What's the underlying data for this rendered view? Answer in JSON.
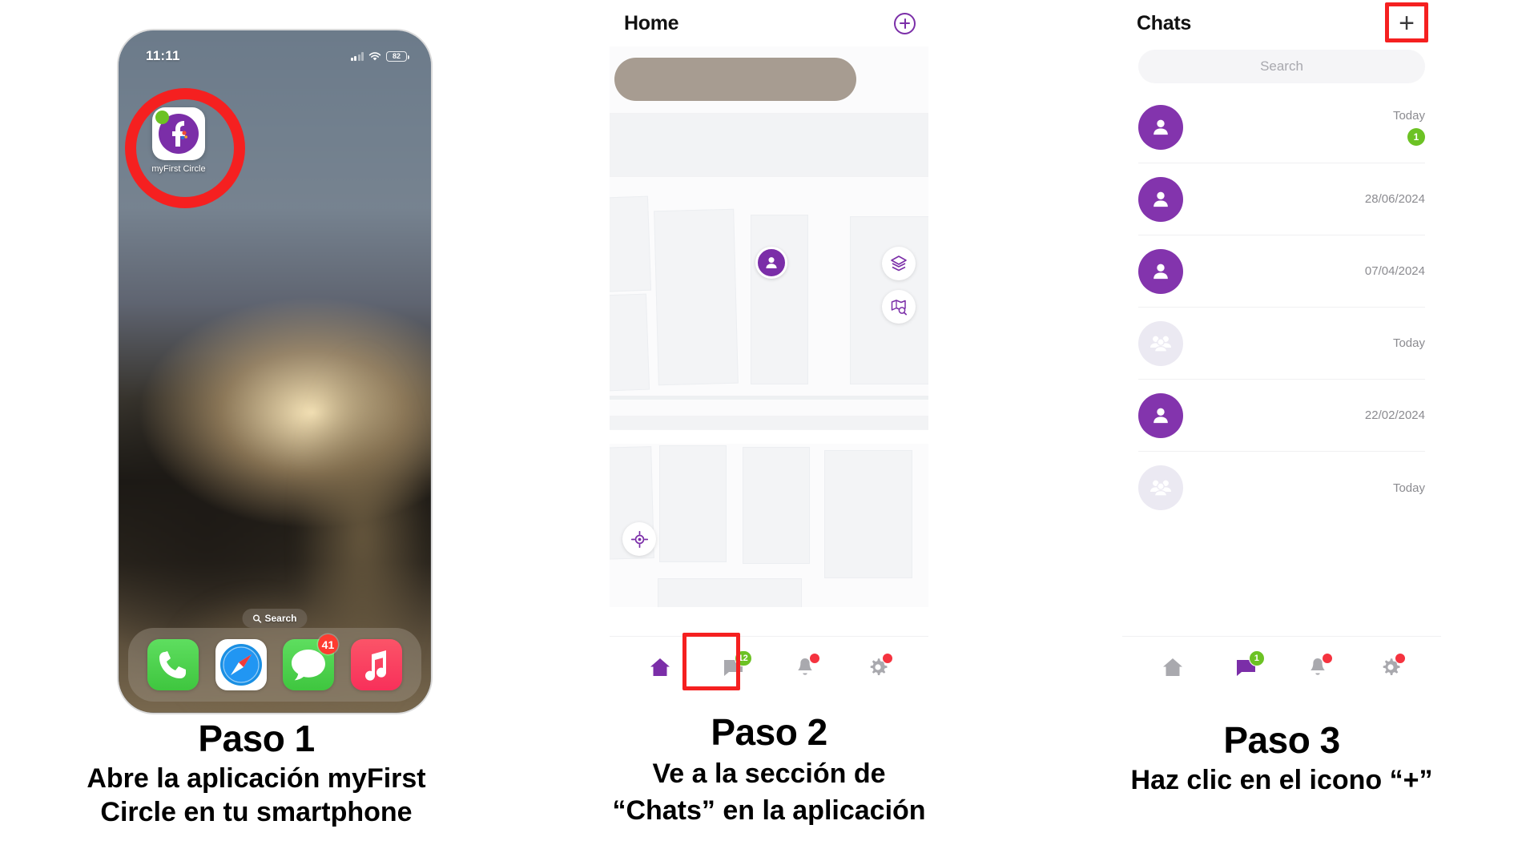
{
  "steps": [
    {
      "title": "Paso 1",
      "body": "Abre la aplicación myFirst\nCircle en tu smartphone"
    },
    {
      "title": "Paso 2",
      "body": "Ve a la sección de\n“Chats” en la aplicación"
    },
    {
      "title": "Paso 3",
      "body": "Haz clic en el icono “+”"
    }
  ],
  "phone1": {
    "status_bar": {
      "time": "11:11",
      "signal_icon": "cellular-signal-icon",
      "wifi_icon": "wifi-icon",
      "battery_level": "82"
    },
    "app_icon": {
      "label": "myFirst Circle",
      "icon_name": "myfirst-circle-app-icon"
    },
    "search_pill": {
      "label": "Search",
      "icon_name": "search-icon"
    },
    "dock": [
      {
        "name": "Phone",
        "icon": "phone-icon",
        "badge": ""
      },
      {
        "name": "Safari",
        "icon": "safari-compass-icon",
        "badge": ""
      },
      {
        "name": "Messages",
        "icon": "messages-bubble-icon",
        "badge": "41"
      },
      {
        "name": "Music",
        "icon": "music-note-icon",
        "badge": ""
      }
    ],
    "highlight": "red-circle-around-app-icon"
  },
  "phone2": {
    "header": {
      "title": "Home",
      "action_icon": "plus-circle-icon"
    },
    "map": {
      "user_marker_icon": "person-marker-icon",
      "controls": [
        {
          "icon": "locate-crosshair-icon"
        },
        {
          "icon": "map-layers-icon"
        },
        {
          "icon": "map-search-icon"
        }
      ]
    },
    "nav": [
      {
        "name": "home",
        "icon": "home-icon",
        "active": true,
        "badge": "",
        "badge_type": "none"
      },
      {
        "name": "chats",
        "icon": "chat-icon",
        "active": false,
        "badge": "12",
        "badge_type": "green"
      },
      {
        "name": "alerts",
        "icon": "bell-icon",
        "active": false,
        "badge": "",
        "badge_type": "reddot"
      },
      {
        "name": "settings",
        "icon": "gear-icon",
        "active": false,
        "badge": "",
        "badge_type": "reddot"
      }
    ],
    "highlight": "red-box-around-chats-tab"
  },
  "phone3": {
    "header": {
      "title": "Chats",
      "action_label": "+",
      "action_icon": "plus-icon"
    },
    "search": {
      "placeholder": "Search"
    },
    "chats": [
      {
        "avatar": "person",
        "date": "Today",
        "unread": "1"
      },
      {
        "avatar": "person",
        "date": "28/06/2024",
        "unread": ""
      },
      {
        "avatar": "person",
        "date": "07/04/2024",
        "unread": ""
      },
      {
        "avatar": "group",
        "date": "Today",
        "unread": ""
      },
      {
        "avatar": "person",
        "date": "22/02/2024",
        "unread": ""
      },
      {
        "avatar": "group",
        "date": "Today",
        "unread": ""
      }
    ],
    "nav": [
      {
        "name": "home",
        "icon": "home-icon",
        "active": false,
        "badge": "",
        "badge_type": "none"
      },
      {
        "name": "chats",
        "icon": "chat-icon",
        "active": true,
        "badge": "1",
        "badge_type": "green"
      },
      {
        "name": "alerts",
        "icon": "bell-icon",
        "active": false,
        "badge": "",
        "badge_type": "reddot"
      },
      {
        "name": "settings",
        "icon": "gear-icon",
        "active": false,
        "badge": "",
        "badge_type": "reddot"
      }
    ],
    "highlight": "red-box-around-plus-button"
  },
  "colors": {
    "brand_purple": "#7b2ea8",
    "avatar_purple": "#8334ad",
    "badge_green": "#6cc224",
    "highlight_red": "#f52020",
    "dot_red": "#f5333f"
  }
}
